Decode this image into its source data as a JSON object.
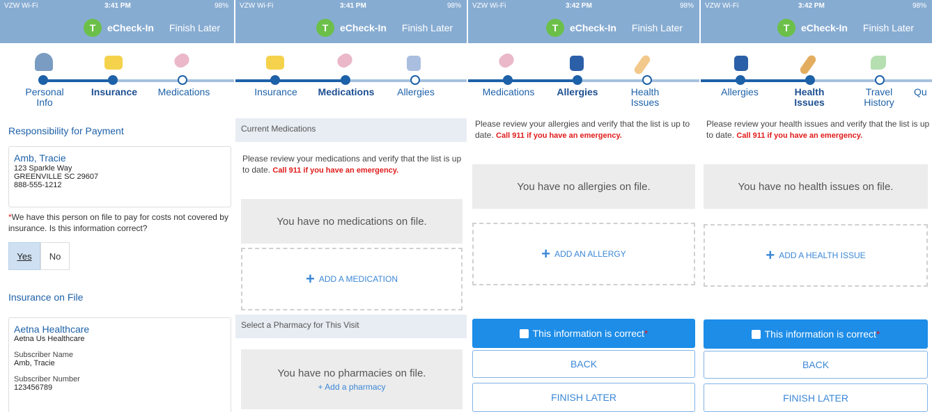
{
  "status": {
    "carrier": "VZW Wi-Fi",
    "times": [
      "3:41 PM",
      "3:41 PM",
      "3:42 PM",
      "3:42 PM"
    ],
    "battery": "98%"
  },
  "app": {
    "avatar": "T",
    "title": "eCheck-In",
    "finish_later": "Finish Later"
  },
  "colors": {
    "header": "#87acd2",
    "primary": "#1d61a8",
    "button": "#1d8de8",
    "warning": "#e01b1b"
  },
  "panel1": {
    "steps": [
      "Personal Info",
      "Insurance",
      "Medications"
    ],
    "responsibility_title": "Responsibility for Payment",
    "person": {
      "name": "Amb, Tracie",
      "address1": "123 Sparkle Way",
      "address2": "GREENVILLE SC 29607",
      "phone": "888-555-1212"
    },
    "question": "We have this person on file to pay for costs not covered by insurance. Is this information correct?",
    "yes": "Yes",
    "no": "No",
    "insurance_title": "Insurance on File",
    "insurance": {
      "name": "Aetna Healthcare",
      "plan": "Aetna Us Healthcare",
      "subscriber_name_label": "Subscriber Name",
      "subscriber_name": "Amb, Tracie",
      "subscriber_number_label": "Subscriber Number",
      "subscriber_number": "123456789"
    }
  },
  "panel2": {
    "steps": [
      "Insurance",
      "Medications",
      "Allergies"
    ],
    "current_header": "Current Medications",
    "message": "Please review your medications and verify that the list is up to date.",
    "warning": "Call 911 if you have an emergency.",
    "empty": "You have no medications on file.",
    "add": "ADD A MEDICATION",
    "pharmacy_header": "Select a Pharmacy for This Visit",
    "pharmacy_empty": "You have no pharmacies on file.",
    "add_pharmacy": "Add a pharmacy"
  },
  "panel3": {
    "steps": [
      "Medications",
      "Allergies",
      "Health Issues"
    ],
    "message": "Please review your allergies and verify that the list is up to date.",
    "warning": "Call 911 if you have an emergency.",
    "empty": "You have no allergies on file.",
    "add": "ADD AN ALLERGY",
    "confirm": "This information is correct",
    "back": "BACK",
    "finish": "FINISH LATER"
  },
  "panel4": {
    "steps": [
      "Allergies",
      "Health Issues",
      "Travel History",
      "Qu"
    ],
    "message": "Please review your health issues and verify that the list is up to date.",
    "warning": "Call 911 if you have an emergency.",
    "empty": "You have no health issues on file.",
    "add": "ADD A HEALTH ISSUE",
    "confirm": "This information is correct",
    "back": "BACK",
    "finish": "FINISH LATER"
  }
}
